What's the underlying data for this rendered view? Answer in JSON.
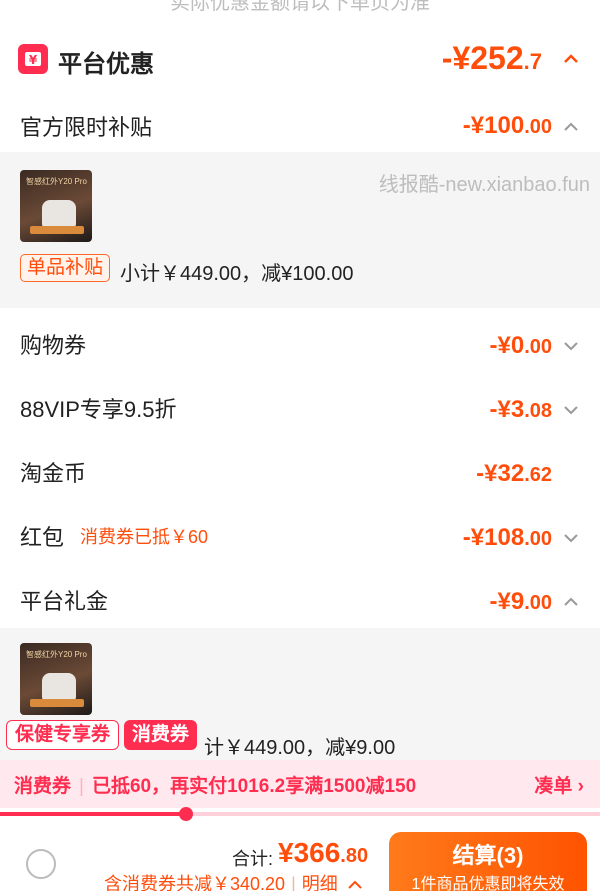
{
  "top_cut_text": "实际优惠金额请以下单页为准",
  "platform": {
    "icon": "yuan-coupon-icon",
    "title": "平台优惠",
    "amount_prefix": "-¥",
    "amount_int": "252",
    "amount_dec": ".7"
  },
  "official_subsidy": {
    "label": "官方限时补贴",
    "amount_prefix": "-¥",
    "amount_int": "100",
    "amount_dec": ".00"
  },
  "subsidy_item": {
    "thumb_text": "智感红外Y20 Pro",
    "tag": "单品补贴",
    "subtotal": "小计￥449.00，减¥100.00"
  },
  "watermark": "线报酷-new.xianbao.fun",
  "shopping_coupon": {
    "label": "购物券",
    "amount_prefix": "-¥",
    "amount_int": "0",
    "amount_dec": ".00"
  },
  "vip": {
    "label": "88VIP专享9.5折",
    "amount_prefix": "-¥",
    "amount_int": "3",
    "amount_dec": ".08"
  },
  "taojinbi": {
    "label": "淘金币",
    "amount_prefix": "-¥",
    "amount_int": "32",
    "amount_dec": ".62"
  },
  "hongbao": {
    "label": "红包",
    "note": "消费券已抵￥60",
    "amount_prefix": "-¥",
    "amount_int": "108",
    "amount_dec": ".00"
  },
  "gift": {
    "label": "平台礼金",
    "amount_prefix": "-¥",
    "amount_int": "9",
    "amount_dec": ".00",
    "thumb_text": "智感红外Y20 Pro",
    "tag1": "保健专享券",
    "tag2": "消费券",
    "subtotal": "计￥449.00，减¥9.00"
  },
  "promo": {
    "part1": "消费券",
    "part2": "已抵60，再实付1016.2享满1500减150",
    "link": "凑单 ›",
    "progress": 0.31
  },
  "footer": {
    "total_label": "合计:",
    "total_prefix": "¥",
    "total_int": "366",
    "total_dec": ".80",
    "discount_text": "含消费券共减￥340.20",
    "detail_text": "明细",
    "checkout_main": "结算(3)",
    "checkout_sub": "1件商品优惠即将失效"
  },
  "colors": {
    "accent": "#ff4d0b",
    "red": "#ff2d4f",
    "promo_bg": "#ffe9ee"
  }
}
